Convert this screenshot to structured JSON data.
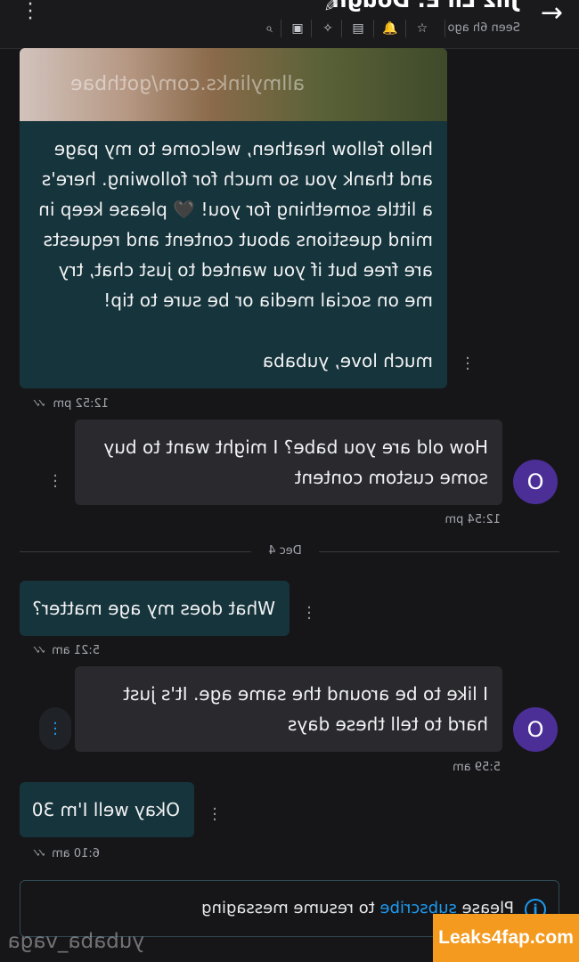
{
  "header": {
    "title": "Jiiz Lil E. Dough",
    "seen": "Seen 6h ago",
    "icons": [
      "arrow-right-icon",
      "edit-icon",
      "star-icon",
      "bell-icon",
      "list-icon",
      "pin-icon",
      "image-icon",
      "search-icon",
      "more-vertical-icon"
    ],
    "accent": "#1d9bf0"
  },
  "messages": [
    {
      "side": "outgoing",
      "has_image": true,
      "image_watermark": "allmylinks.com/gothbae",
      "text": "hello fellow heathen, welcome to my page\nand thank you so much for following. here's\na little something for you! 🖤 please keep in\nmind questions about content and requests\nare free but if you wanted to just chat, try\nme on social media or be sure to tip!\n\nmuch love, yubaba",
      "time": "12:52 pm"
    },
    {
      "side": "incoming",
      "avatar": "O",
      "text": "How old are you babe? I might want to buy\nsome custom content",
      "time": "12:54 pm"
    },
    {
      "side": "outgoing",
      "text": "What does my age matter?",
      "time": "5:21 am"
    },
    {
      "side": "incoming",
      "avatar": "O",
      "text": "I like to be around the same age. It's just\nhard to tell these days",
      "time": "5:59 am"
    },
    {
      "side": "outgoing",
      "text": "Okay well I'm 30",
      "time": "6:10 am"
    }
  ],
  "date_divider": "Dec 4",
  "footer": {
    "prefix": "Please ",
    "link": "subscribe",
    "suffix": " to resume messaging",
    "username_watermark": "yubaba_vaga"
  },
  "site_badge": "Leaks4fap.com",
  "colors": {
    "background": "#161619",
    "outgoing_bubble": "#16343b",
    "incoming_bubble": "#2a2a2e",
    "avatar": "#4b2f97",
    "badge": "#f49a1e"
  }
}
